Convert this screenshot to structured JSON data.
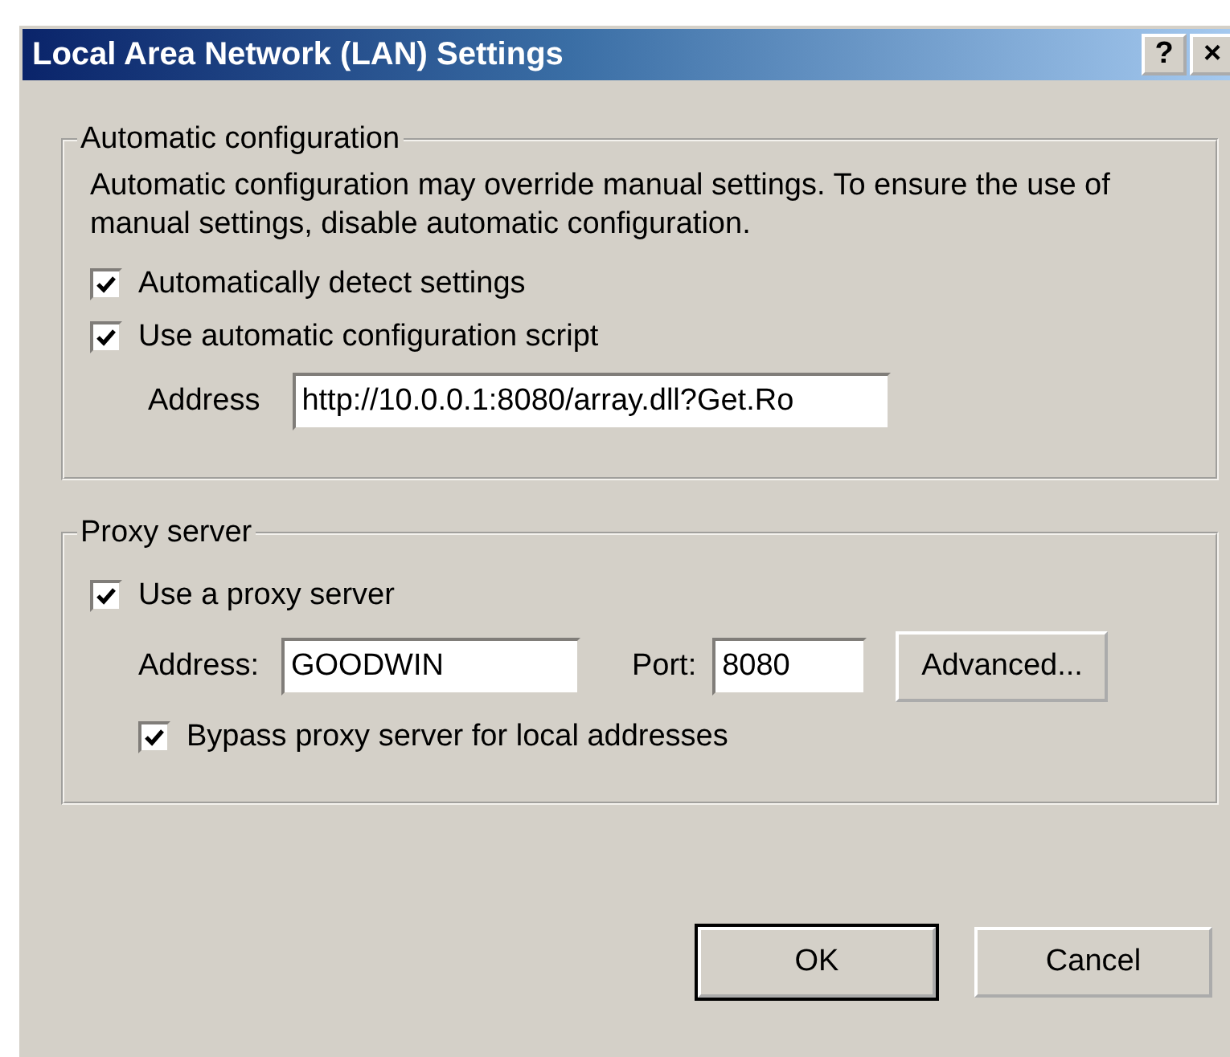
{
  "window": {
    "title": "Local Area Network (LAN) Settings",
    "title_buttons": [
      "?",
      "×"
    ]
  },
  "automatic_configuration": {
    "title": "Automatic configuration",
    "description": "Automatic configuration may override manual settings.  To ensure the use of manual settings, disable automatic configuration.",
    "options": [
      {
        "label": "Automatically detect settings",
        "checked": true
      },
      {
        "label": "Use automatic configuration script",
        "checked": true
      }
    ],
    "address": {
      "label": "Address",
      "value": "http://10.0.0.1:8080/array.dll?Get.Ro"
    }
  },
  "proxy_server": {
    "title": "Proxy server",
    "use_proxy": {
      "label": "Use a proxy server",
      "checked": true
    },
    "address": {
      "label": "Address:",
      "value": "GOODWIN"
    },
    "port": {
      "label": "Port:",
      "value": "8080"
    },
    "advanced_button": {
      "label": "Advanced..."
    },
    "bypass": {
      "label": "Bypass proxy server for local addresses",
      "checked": true
    }
  },
  "buttons": [
    {
      "label": "OK",
      "default": true
    },
    {
      "label": "Cancel",
      "default": false
    }
  ]
}
